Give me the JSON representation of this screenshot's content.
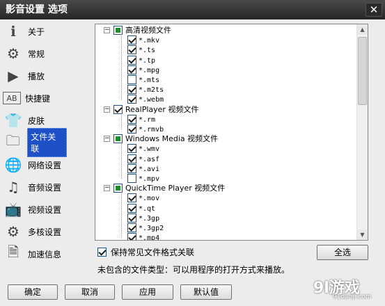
{
  "window": {
    "title": "影音设置 选项",
    "close_label": "✕"
  },
  "sidebar": {
    "items": [
      {
        "label": "关于",
        "icon": "info-icon",
        "glyph": "ℹ"
      },
      {
        "label": "常规",
        "icon": "gear-icon",
        "glyph": "⚙"
      },
      {
        "label": "播放",
        "icon": "play-icon",
        "glyph": "▶"
      },
      {
        "label": "快捷键",
        "icon": "keyboard-icon",
        "glyph": "AB"
      },
      {
        "label": "皮肤",
        "icon": "shirt-icon",
        "glyph": "👕"
      },
      {
        "label": "文件关联",
        "icon": "folder-icon",
        "glyph": "🗀"
      },
      {
        "label": "网络设置",
        "icon": "globe-icon",
        "glyph": "🌐"
      },
      {
        "label": "音频设置",
        "icon": "audio-icon",
        "glyph": "♫"
      },
      {
        "label": "视频设置",
        "icon": "tv-icon",
        "glyph": "📺"
      },
      {
        "label": "多核设置",
        "icon": "cpu-icon",
        "glyph": "⚙"
      },
      {
        "label": "加速信息",
        "icon": "document-icon",
        "glyph": "🗎"
      }
    ],
    "selected_index": 5
  },
  "tree": {
    "groups": [
      {
        "label": "高清视频文件",
        "state": "partial",
        "items": [
          {
            "label": "*.mkv",
            "checked": true
          },
          {
            "label": "*.ts",
            "checked": true
          },
          {
            "label": "*.tp",
            "checked": true
          },
          {
            "label": "*.mpg",
            "checked": true
          },
          {
            "label": "*.mts",
            "checked": false
          },
          {
            "label": "*.m2ts",
            "checked": true
          },
          {
            "label": "*.webm",
            "checked": true
          }
        ]
      },
      {
        "label": "RealPlayer 视频文件",
        "state": "checked",
        "items": [
          {
            "label": "*.rm",
            "checked": true
          },
          {
            "label": "*.rmvb",
            "checked": true
          }
        ]
      },
      {
        "label": "Windows Media 视频文件",
        "state": "partial",
        "items": [
          {
            "label": "*.wmv",
            "checked": true
          },
          {
            "label": "*.asf",
            "checked": true
          },
          {
            "label": "*.avi",
            "checked": true
          },
          {
            "label": "*.mpv",
            "checked": false
          }
        ]
      },
      {
        "label": "QuickTime Player 视频文件",
        "state": "partial",
        "items": [
          {
            "label": "*.mov",
            "checked": true
          },
          {
            "label": "*.qt",
            "checked": true
          },
          {
            "label": "*.3gp",
            "checked": true
          },
          {
            "label": "*.3gp2",
            "checked": true
          },
          {
            "label": "*.mp4",
            "checked": true
          }
        ]
      }
    ]
  },
  "keep_associations": {
    "label": "保持常见文件格式关联",
    "checked": true
  },
  "select_all_label": "全选",
  "hint": "未包含的文件类型：可以用程序的打开方式来播放。",
  "buttons": {
    "ok": "确定",
    "cancel": "取消",
    "apply": "应用",
    "defaults": "默认值"
  },
  "watermark": {
    "main": "9l游戏",
    "sub": "91danji.com"
  }
}
